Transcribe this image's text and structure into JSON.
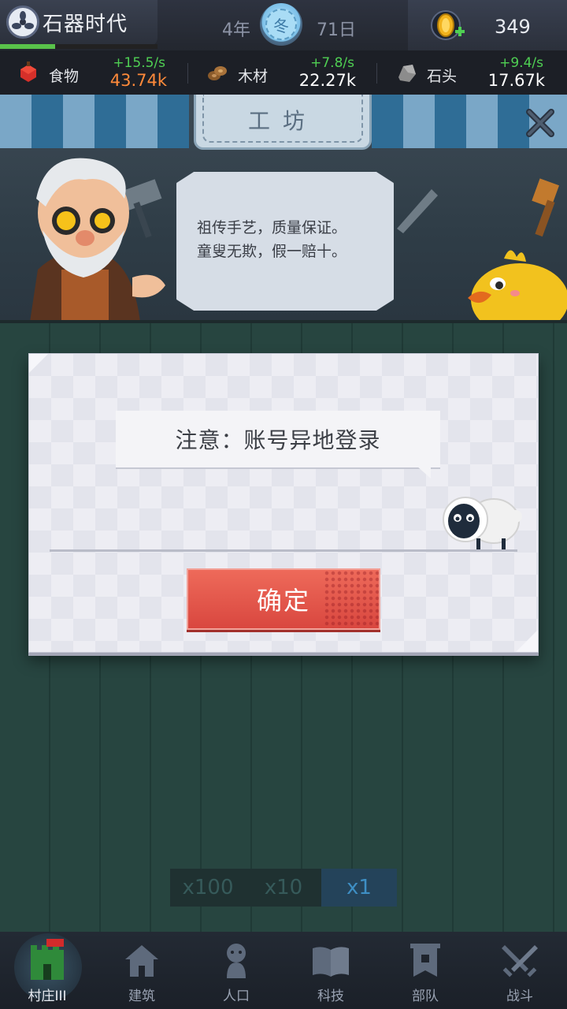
{
  "header": {
    "era_title": "石器时代",
    "era_progress": 0.35,
    "year": "4年",
    "season": "冬",
    "day": "71日",
    "gem_count": "349"
  },
  "resources": [
    {
      "name": "食物",
      "rate": "+15.5/s",
      "value": "43.74k",
      "value_color": "#ff8a3a",
      "icon": "meat-icon"
    },
    {
      "name": "木材",
      "rate": "+7.8/s",
      "value": "22.27k",
      "value_color": "#ffffff",
      "icon": "wood-icon"
    },
    {
      "name": "石头",
      "rate": "+9.4/s",
      "value": "17.67k",
      "value_color": "#ffffff",
      "icon": "stone-icon"
    }
  ],
  "workshop": {
    "title": "工坊",
    "speech_line1": "祖传手艺，质量保证。",
    "speech_line2": "童叟无欺，假一赔十。"
  },
  "dialog": {
    "message": "注意：账号异地登录",
    "confirm_label": "确定"
  },
  "multiplier": {
    "options": [
      "x100",
      "x10",
      "x1"
    ],
    "selected": "x1"
  },
  "nav": {
    "items": [
      {
        "label": "村庄III",
        "icon": "castle-icon",
        "active": true
      },
      {
        "label": "建筑",
        "icon": "house-icon",
        "active": false
      },
      {
        "label": "人口",
        "icon": "person-icon",
        "active": false
      },
      {
        "label": "科技",
        "icon": "book-icon",
        "active": false
      },
      {
        "label": "部队",
        "icon": "banner-icon",
        "active": false
      },
      {
        "label": "战斗",
        "icon": "swords-icon",
        "active": false
      }
    ]
  },
  "colors": {
    "accent_green": "#4fcf53",
    "confirm_red": "#e0524a",
    "food_orange": "#ff8a3a"
  }
}
